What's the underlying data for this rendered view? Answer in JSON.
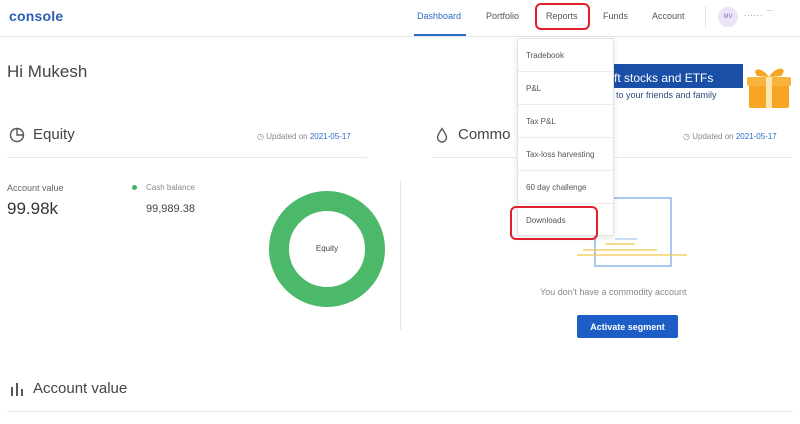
{
  "app": {
    "logo": "console"
  },
  "nav": {
    "items": [
      {
        "label": "Dashboard",
        "active": true
      },
      {
        "label": "Portfolio",
        "active": false
      },
      {
        "label": "Reports",
        "active": false
      },
      {
        "label": "Funds",
        "active": false
      },
      {
        "label": "Account",
        "active": false
      }
    ],
    "user": {
      "initials": "MV",
      "name": "...... ¨¨"
    }
  },
  "greeting": "Hi Mukesh",
  "banner": {
    "line1": "ft stocks and ETFs",
    "line2": "to your friends and family",
    "icon": "gift-icon"
  },
  "equity": {
    "title": "Equity",
    "icon": "pie-chart-icon",
    "updated_prefix": "Updated on",
    "updated_date": "2021-05-17",
    "account_value_label": "Account value",
    "account_value": "99.98k",
    "cash_balance_label": "Cash balance",
    "cash_balance": "99,989.38",
    "donut_label": "Equity",
    "donut_color": "#4cb96a"
  },
  "commodity": {
    "title": "Commo",
    "icon": "droplet-icon",
    "updated_prefix": "Updated on",
    "updated_date": "2021-05-17",
    "empty_message": "You don't have a commodity account",
    "activate_button": "Activate segment"
  },
  "account_value_section": {
    "title": "Account value",
    "icon": "bar-chart-icon"
  },
  "reports_dropdown": {
    "items": [
      "Tradebook",
      "P&L",
      "Tax P&L",
      "Tax-loss harvesting",
      "60 day challenge",
      "Downloads"
    ]
  },
  "colors": {
    "brand": "#2b5fb3",
    "accent": "#2b6cc4",
    "highlight": "#e0202a",
    "button": "#1c5ec6"
  }
}
